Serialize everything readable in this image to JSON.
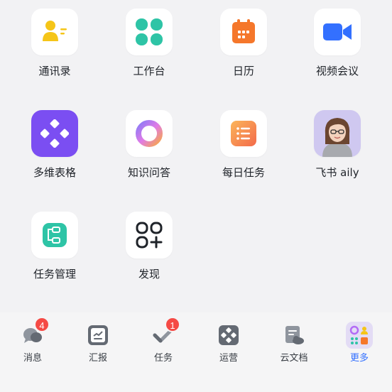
{
  "apps": [
    {
      "label": "通讯录",
      "icon": "contacts-icon",
      "color": "#f5c518"
    },
    {
      "label": "工作台",
      "icon": "workbench-icon",
      "color": "#2ec4a6"
    },
    {
      "label": "日历",
      "icon": "calendar-icon",
      "color": "#f5772b"
    },
    {
      "label": "视频会议",
      "icon": "video-meeting-icon",
      "color": "#3370ff"
    },
    {
      "label": "多维表格",
      "icon": "base-table-icon",
      "color": "#7b4ef2"
    },
    {
      "label": "知识问答",
      "icon": "knowledge-qa-icon",
      "color": "#b36bf5"
    },
    {
      "label": "每日任务",
      "icon": "daily-tasks-icon",
      "color": "#f78b4e"
    },
    {
      "label": "飞书 aily",
      "icon": "aily-avatar-icon",
      "color": "#c9c3f0"
    },
    {
      "label": "任务管理",
      "icon": "task-management-icon",
      "color": "#2ec4a6"
    },
    {
      "label": "发现",
      "icon": "discover-icon",
      "color": "#1f2329"
    }
  ],
  "tabbar": {
    "items": [
      {
        "label": "消息",
        "icon": "chat-bubbles-icon",
        "badge": "4"
      },
      {
        "label": "汇报",
        "icon": "report-icon"
      },
      {
        "label": "任务",
        "icon": "task-check-icon",
        "badge": "1"
      },
      {
        "label": "运营",
        "icon": "operations-icon"
      },
      {
        "label": "云文档",
        "icon": "cloud-docs-icon"
      },
      {
        "label": "更多",
        "icon": "more-apps-icon",
        "active": true
      }
    ],
    "active_color": "#3370ff",
    "badge_color": "#f54a45"
  }
}
